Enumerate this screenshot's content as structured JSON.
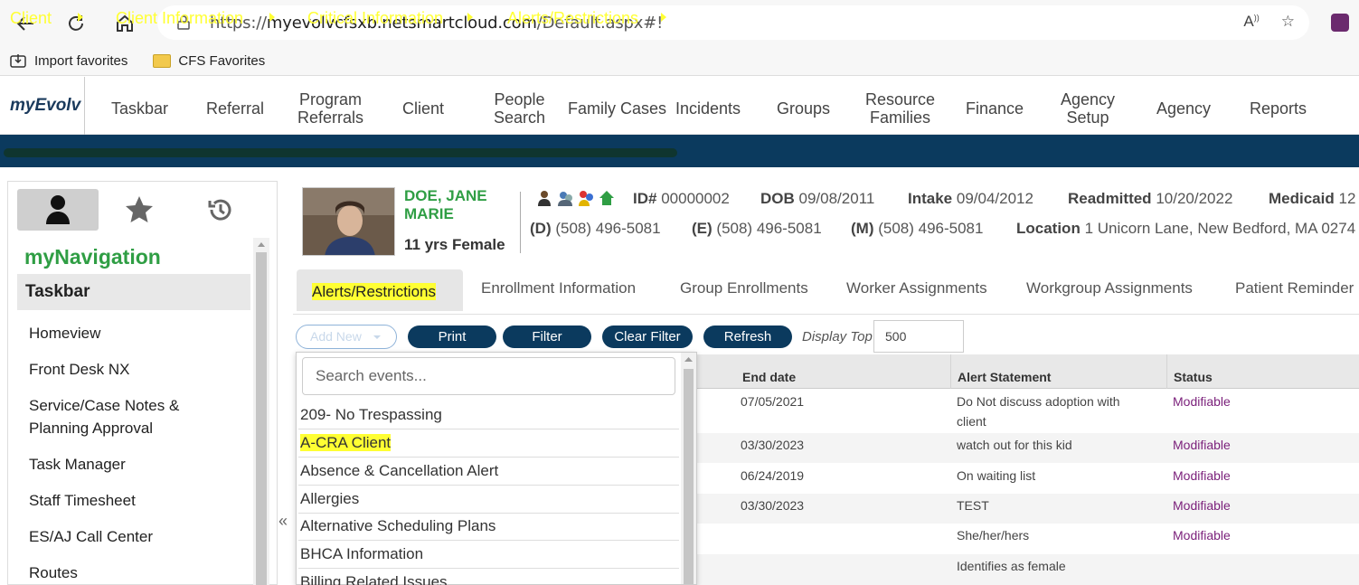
{
  "browser": {
    "url_prefix": "https://",
    "url_host": "myevolvcfsxb.netsmartcloud.com",
    "url_path": "/Default.aspx#!",
    "favorites": [
      {
        "label": "Import favorites",
        "icon": "import-icon"
      },
      {
        "label": "CFS Favorites",
        "icon": "folder-icon"
      }
    ]
  },
  "app": {
    "brand": "myEvolv",
    "menu": [
      {
        "label": "Taskbar"
      },
      {
        "label": "Referral"
      },
      {
        "label": "Program\nReferrals"
      },
      {
        "label": "Client"
      },
      {
        "label": "People\nSearch"
      },
      {
        "label": "Family Cases"
      },
      {
        "label": "Incidents"
      },
      {
        "label": "Groups"
      },
      {
        "label": "Resource\nFamilies"
      },
      {
        "label": "Finance"
      },
      {
        "label": "Agency\nSetup"
      },
      {
        "label": "Agency"
      },
      {
        "label": "Reports"
      }
    ],
    "breadcrumb": [
      "Client",
      "Client Information",
      "Critical Information",
      "Alerts/Restrictions"
    ]
  },
  "sidebar": {
    "title": "myNavigation",
    "section": "Taskbar",
    "items": [
      "Homeview",
      "Front Desk NX",
      "Service/Case Notes &\nPlanning Approval",
      "Task Manager",
      "Staff Timesheet",
      "ES/AJ Call Center",
      "Routes"
    ],
    "collapse_glyph": "«"
  },
  "client": {
    "name_line1": "DOE, JANE",
    "name_line2": "MARIE",
    "age_sex": "11 yrs Female",
    "id_label": "ID#",
    "id_value": "00000002",
    "dob_label": "DOB",
    "dob_value": "09/08/2011",
    "intake_label": "Intake",
    "intake_value": "09/04/2012",
    "readmitted_label": "Readmitted",
    "readmitted_value": "10/20/2022",
    "medicaid_label": "Medicaid",
    "medicaid_value": "12",
    "phone_d_label": "(D)",
    "phone_d": "(508) 496-5081",
    "phone_e_label": "(E)",
    "phone_e": "(508) 496-5081",
    "phone_m_label": "(M)",
    "phone_m": "(508) 496-5081",
    "location_label": "Location",
    "location_value": "1 Unicorn Lane, New Bedford, MA 0274"
  },
  "tabs": [
    "Alerts/Restrictions",
    "Enrollment Information",
    "Group Enrollments",
    "Worker Assignments",
    "Workgroup Assignments",
    "Patient Reminder"
  ],
  "toolbar": {
    "add_new": "Add New",
    "print": "Print",
    "filter": "Filter",
    "clear_filter": "Clear Filter",
    "refresh": "Refresh",
    "display_top_label": "Display Top",
    "display_top_value": "500"
  },
  "grid": {
    "headers": [
      "End date",
      "Alert Statement",
      "Status"
    ],
    "rows": [
      {
        "end_date": "07/05/2021",
        "statement": "Do Not discuss adoption with\nclient",
        "status": "Modifiable"
      },
      {
        "end_date": "03/30/2023",
        "statement": "watch out for this kid",
        "status": "Modifiable"
      },
      {
        "end_date": "06/24/2019",
        "statement": "On waiting list",
        "status": "Modifiable"
      },
      {
        "end_date": "03/30/2023",
        "statement": "TEST",
        "status": "Modifiable"
      },
      {
        "end_date": "",
        "statement": "She/her/hers",
        "status": "Modifiable"
      },
      {
        "end_date": "",
        "statement": "Identifies as female",
        "status": ""
      }
    ]
  },
  "dropdown": {
    "search_placeholder": "Search events...",
    "options": [
      "209- No Trespassing",
      "A-CRA Client",
      "Absence & Cancellation Alert",
      "Allergies",
      "Alternative Scheduling Plans",
      "BHCA Information",
      "Billing Related Issues"
    ]
  },
  "colors": {
    "brand_navy": "#0b3a5e",
    "breadcrumb_text": "#ffff33",
    "nav_green": "#2f9e44",
    "status_purple": "#7a1f7a",
    "highlight": "#ffff33"
  }
}
